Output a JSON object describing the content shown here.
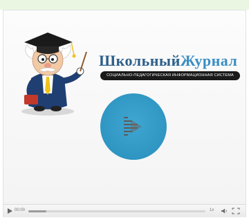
{
  "logo": {
    "title_part1": "Школьный",
    "title_part2": "Журнал",
    "subtitle": "СОЦИАЛЬНО-ПЕДАГОГИЧЕСКАЯ ИНФОРМАЦИОННАЯ СИСТЕМА"
  },
  "player": {
    "play_icon": "play-icon",
    "accent_color": "#2f95c2",
    "controls": {
      "time": "00:00",
      "progress_fraction": 0.1,
      "speed": "1x"
    }
  },
  "icons": [
    "professor-mascot",
    "play-icon",
    "volume-icon",
    "fullscreen-icon"
  ]
}
